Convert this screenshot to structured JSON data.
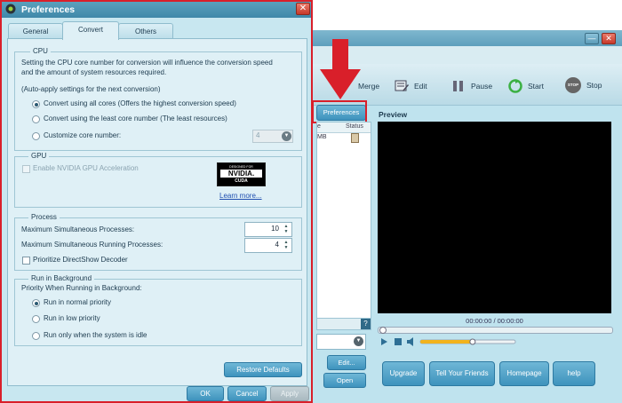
{
  "app": {
    "toolbar": {
      "merge": "Merge",
      "edit": "Edit",
      "pause": "Pause",
      "start": "Start",
      "stop": "Stop",
      "stop_icon_text": "STOP"
    },
    "preferences_button": "Preferences",
    "filelist_headers": [
      "e",
      "Status"
    ],
    "filelist_first_cell": "MB",
    "profile_edit": "Edit...",
    "open": "Open",
    "preview_label": "Preview",
    "timecode": "00:00:00 / 00:00:00",
    "volume_percent": 55,
    "buttons": {
      "upgrade": "Upgrade",
      "tell_friends": "Tell Your Friends",
      "homepage": "Homepage",
      "help": "help"
    }
  },
  "dialog": {
    "title": "Preferences",
    "tabs": [
      "General",
      "Convert",
      "Others"
    ],
    "active_tab": "Convert",
    "cpu": {
      "legend": "CPU",
      "description": [
        "Setting the CPU core number for conversion will influence the conversion speed",
        "and the amount of system resources required."
      ],
      "auto_apply": "(Auto-apply settings for the next conversion)",
      "options": [
        {
          "label": "Convert using all cores (Offers the highest conversion speed)",
          "selected": true
        },
        {
          "label": "Convert using the least core number (The least resources)",
          "selected": false
        },
        {
          "label": "Customize core number:",
          "selected": false
        }
      ],
      "core_number": "4"
    },
    "gpu": {
      "legend": "GPU",
      "enable_label": "Enable NVIDIA GPU Acceleration",
      "badge": [
        "DESIGNED FOR",
        "NVIDIA.",
        "CUDA"
      ],
      "learn_more": "Learn more..."
    },
    "process": {
      "legend": "Process",
      "max_simultaneous_label": "Maximum Simultaneous Processes:",
      "max_simultaneous_value": "10",
      "max_running_label": "Maximum Simultaneous Running Processes:",
      "max_running_value": "4",
      "prioritize_label": "Prioritize DirectShow Decoder"
    },
    "background": {
      "legend": "Run in Background",
      "priority_label": "Priority When Running in Background:",
      "options": [
        {
          "label": "Run in normal priority",
          "selected": true
        },
        {
          "label": "Run in low priority",
          "selected": false
        },
        {
          "label": "Run only when the system is idle",
          "selected": false
        }
      ]
    },
    "restore_defaults": "Restore Defaults",
    "ok": "OK",
    "cancel": "Cancel",
    "apply": "Apply"
  },
  "colors": {
    "accent_red": "#d91f2a",
    "button_blue": "#3e93bd",
    "dialog_bg": "#c8e7f0",
    "link": "#1f4fb0"
  }
}
